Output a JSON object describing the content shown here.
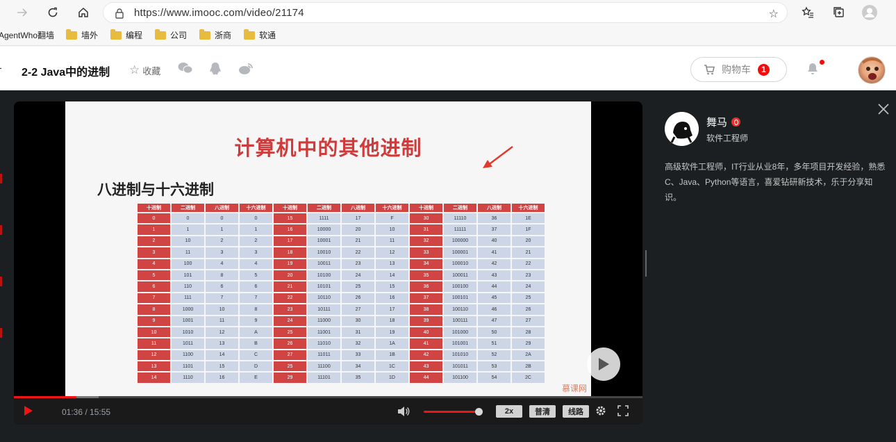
{
  "browser": {
    "url": "https://www.imooc.com/video/21174",
    "bookmarks": [
      {
        "label": "AgentWho翻墙",
        "folder": false
      },
      {
        "label": "墙外",
        "folder": true
      },
      {
        "label": "编程",
        "folder": true
      },
      {
        "label": "公司",
        "folder": true
      },
      {
        "label": "浙商",
        "folder": true
      },
      {
        "label": "软通",
        "folder": true
      }
    ]
  },
  "header": {
    "course_title": "2-2 Java中的进制",
    "favorite_label": "收藏",
    "cart_label": "购物车",
    "cart_count": "1"
  },
  "slide": {
    "title": "计算机中的其他进制",
    "subtitle": "八进制与十六进制",
    "columns": [
      "十进制",
      "二进制",
      "八进制",
      "十六进制",
      "十进制",
      "二进制",
      "八进制",
      "十六进制",
      "十进制",
      "二进制",
      "八进制",
      "十六进制"
    ],
    "rows": [
      [
        "0",
        "0",
        "0",
        "0",
        "15",
        "1111",
        "17",
        "F",
        "30",
        "11110",
        "36",
        "1E"
      ],
      [
        "1",
        "1",
        "1",
        "1",
        "16",
        "10000",
        "20",
        "10",
        "31",
        "11111",
        "37",
        "1F"
      ],
      [
        "2",
        "10",
        "2",
        "2",
        "17",
        "10001",
        "21",
        "11",
        "32",
        "100000",
        "40",
        "20"
      ],
      [
        "3",
        "11",
        "3",
        "3",
        "18",
        "10010",
        "22",
        "12",
        "33",
        "100001",
        "41",
        "21"
      ],
      [
        "4",
        "100",
        "4",
        "4",
        "19",
        "10011",
        "23",
        "13",
        "34",
        "100010",
        "42",
        "22"
      ],
      [
        "5",
        "101",
        "8",
        "5",
        "20",
        "10100",
        "24",
        "14",
        "35",
        "100011",
        "43",
        "23"
      ],
      [
        "6",
        "110",
        "6",
        "6",
        "21",
        "10101",
        "25",
        "15",
        "36",
        "100100",
        "44",
        "24"
      ],
      [
        "7",
        "111",
        "7",
        "7",
        "22",
        "10110",
        "26",
        "16",
        "37",
        "100101",
        "45",
        "25"
      ],
      [
        "8",
        "1000",
        "10",
        "8",
        "23",
        "10111",
        "27",
        "17",
        "38",
        "100110",
        "46",
        "26"
      ],
      [
        "9",
        "1001",
        "11",
        "9",
        "24",
        "11000",
        "30",
        "18",
        "39",
        "100111",
        "47",
        "27"
      ],
      [
        "10",
        "1010",
        "12",
        "A",
        "25",
        "11001",
        "31",
        "19",
        "40",
        "101000",
        "50",
        "28"
      ],
      [
        "11",
        "1011",
        "13",
        "B",
        "26",
        "11010",
        "32",
        "1A",
        "41",
        "101001",
        "51",
        "29"
      ],
      [
        "12",
        "1100",
        "14",
        "C",
        "27",
        "11011",
        "33",
        "1B",
        "42",
        "101010",
        "52",
        "2A"
      ],
      [
        "13",
        "1101",
        "15",
        "D",
        "25",
        "11100",
        "34",
        "1C",
        "43",
        "101011",
        "53",
        "2B"
      ],
      [
        "14",
        "1110",
        "16",
        "E",
        "29",
        "11101",
        "35",
        "1D",
        "44",
        "101100",
        "54",
        "2C"
      ]
    ],
    "watermark": "慕课网"
  },
  "player": {
    "time": "01:36 / 15:55",
    "progress": 0.1,
    "volume": 0.92,
    "speed_label": "2x",
    "quality_label": "普清",
    "route_label": "线路"
  },
  "teacher": {
    "name": "舞马",
    "role": "软件工程师",
    "description": "高级软件工程师，IT行业从业8年，多年项目开发经验，熟悉C、Java、Python等语言，喜爱钻研新技术，乐于分享知识。"
  },
  "colors": {
    "accent": "#f01414",
    "slide_red": "#d04444",
    "cell_blue": "#cdd6e6",
    "dark_bg": "#1c1f21"
  }
}
